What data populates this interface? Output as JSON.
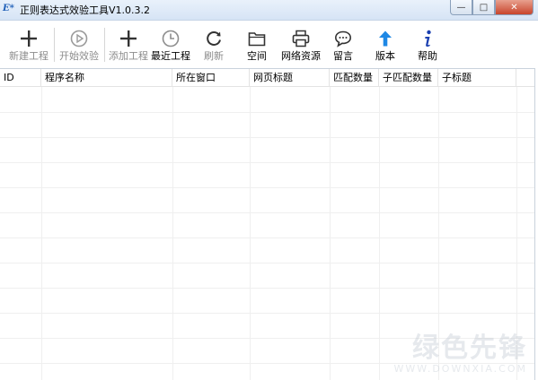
{
  "window": {
    "title": "正则表达式效验工具V1.0.3.2",
    "icon_text": "E*",
    "buttons": {
      "minimize": "—",
      "maximize": "□",
      "close": "✕"
    }
  },
  "toolbar": {
    "items": [
      {
        "label": "新建工程",
        "icon": "plus-icon",
        "enabled": false
      },
      {
        "label": "开始效验",
        "icon": "play-circle-icon",
        "enabled": false
      },
      {
        "label": "添加工程",
        "icon": "plus-icon",
        "enabled": false
      },
      {
        "label": "最近工程",
        "icon": "clock-icon",
        "enabled": true
      },
      {
        "label": "刷新",
        "icon": "refresh-icon",
        "enabled": false
      },
      {
        "label": "空间",
        "icon": "folder-icon",
        "enabled": true
      },
      {
        "label": "网络资源",
        "icon": "printer-icon",
        "enabled": true
      },
      {
        "label": "留言",
        "icon": "chat-bubble-icon",
        "enabled": true
      },
      {
        "label": "版本",
        "icon": "arrow-up-icon",
        "enabled": true
      },
      {
        "label": "帮助",
        "icon": "info-icon",
        "enabled": true
      }
    ]
  },
  "table": {
    "columns": [
      "ID",
      "程序名称",
      "所在窗口",
      "网页标题",
      "匹配数量",
      "子匹配数量",
      "子标题"
    ],
    "rows": []
  },
  "watermark": {
    "main": "绿色先锋",
    "sub": "WWW.DOWNXIA.COM"
  },
  "colors": {
    "accent_blue": "#1e88e5",
    "info_blue": "#1a3fb0",
    "disabled_text": "#8c8c8c"
  }
}
